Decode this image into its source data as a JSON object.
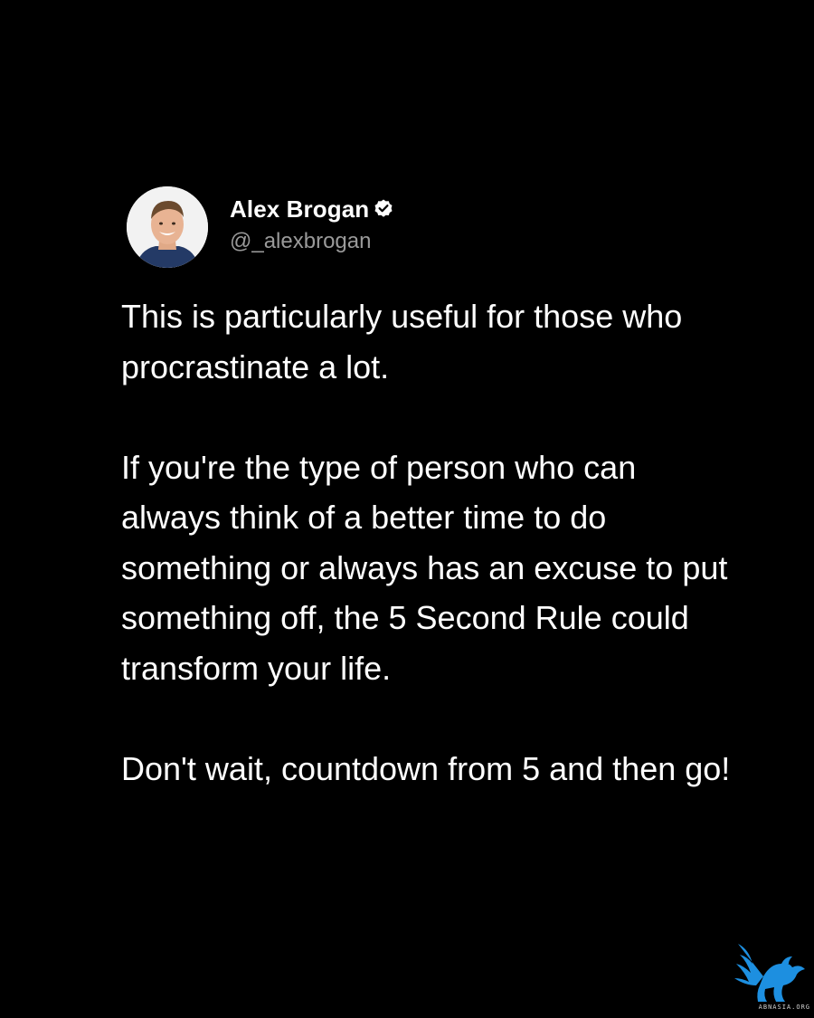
{
  "author": {
    "name": "Alex Brogan",
    "handle": "@_alexbrogan",
    "verified_icon": "verified-badge-icon",
    "avatar_icon": "profile-photo"
  },
  "tweet": {
    "paragraphs": [
      "This is particularly useful for those who procrastinate a lot.",
      "If you're the type of person who can always think of a better time to do something or always has an excuse to put something off, the 5 Second Rule could transform your life.",
      "Don't wait, countdown from 5 and then go!"
    ]
  },
  "watermark": {
    "icon": "winged-lion-logo",
    "text": "ABNASIA.ORG",
    "color": "#1d8fe0"
  },
  "colors": {
    "background": "#000000",
    "text": "#ffffff",
    "handle": "#9a9a9a"
  }
}
